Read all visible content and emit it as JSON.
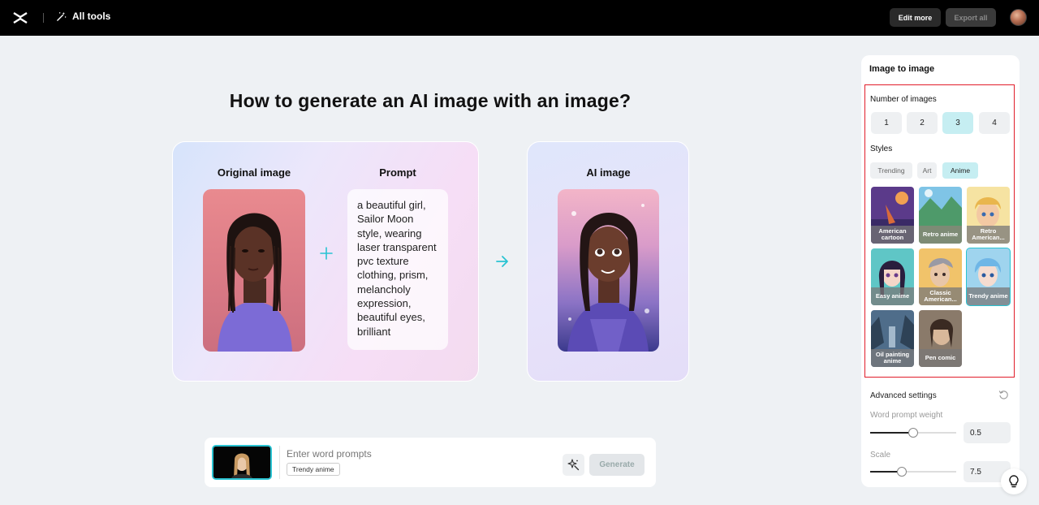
{
  "topbar": {
    "all_tools": "All tools",
    "edit_more": "Edit more",
    "export_all": "Export all"
  },
  "main": {
    "title": "How to generate an AI image with an image?",
    "original_label": "Original image",
    "prompt_label": "Prompt",
    "ai_label": "AI image",
    "prompt_text": "a beautiful girl, Sailor Moon style, wearing laser transparent pvc texture clothing, prism, melancholy expression, beautiful eyes, brilliant"
  },
  "prompt_bar": {
    "placeholder": "Enter word prompts",
    "tag": "Trendy anime",
    "generate": "Generate"
  },
  "panel": {
    "title": "Image to image",
    "number_label": "Number of images",
    "numbers": [
      "1",
      "2",
      "3",
      "4"
    ],
    "selected_number": "3",
    "styles_label": "Styles",
    "style_tabs": [
      "Trending",
      "Art",
      "Anime"
    ],
    "active_tab": "Anime",
    "style_tiles": [
      {
        "label": "American cartoon"
      },
      {
        "label": "Retro anime"
      },
      {
        "label": "Retro American..."
      },
      {
        "label": "Easy anime"
      },
      {
        "label": "Classic American..."
      },
      {
        "label": "Trendy anime"
      },
      {
        "label": "Oil painting anime"
      },
      {
        "label": "Pen comic"
      }
    ],
    "selected_tile": "Trendy anime",
    "advanced_label": "Advanced settings",
    "word_weight_label": "Word prompt weight",
    "word_weight_value": "0.5",
    "scale_label": "Scale",
    "scale_value": "7.5"
  },
  "colors": {
    "accent": "#29c3d2",
    "highlight": "#e11d2a",
    "active_bg": "#c6eef2"
  }
}
